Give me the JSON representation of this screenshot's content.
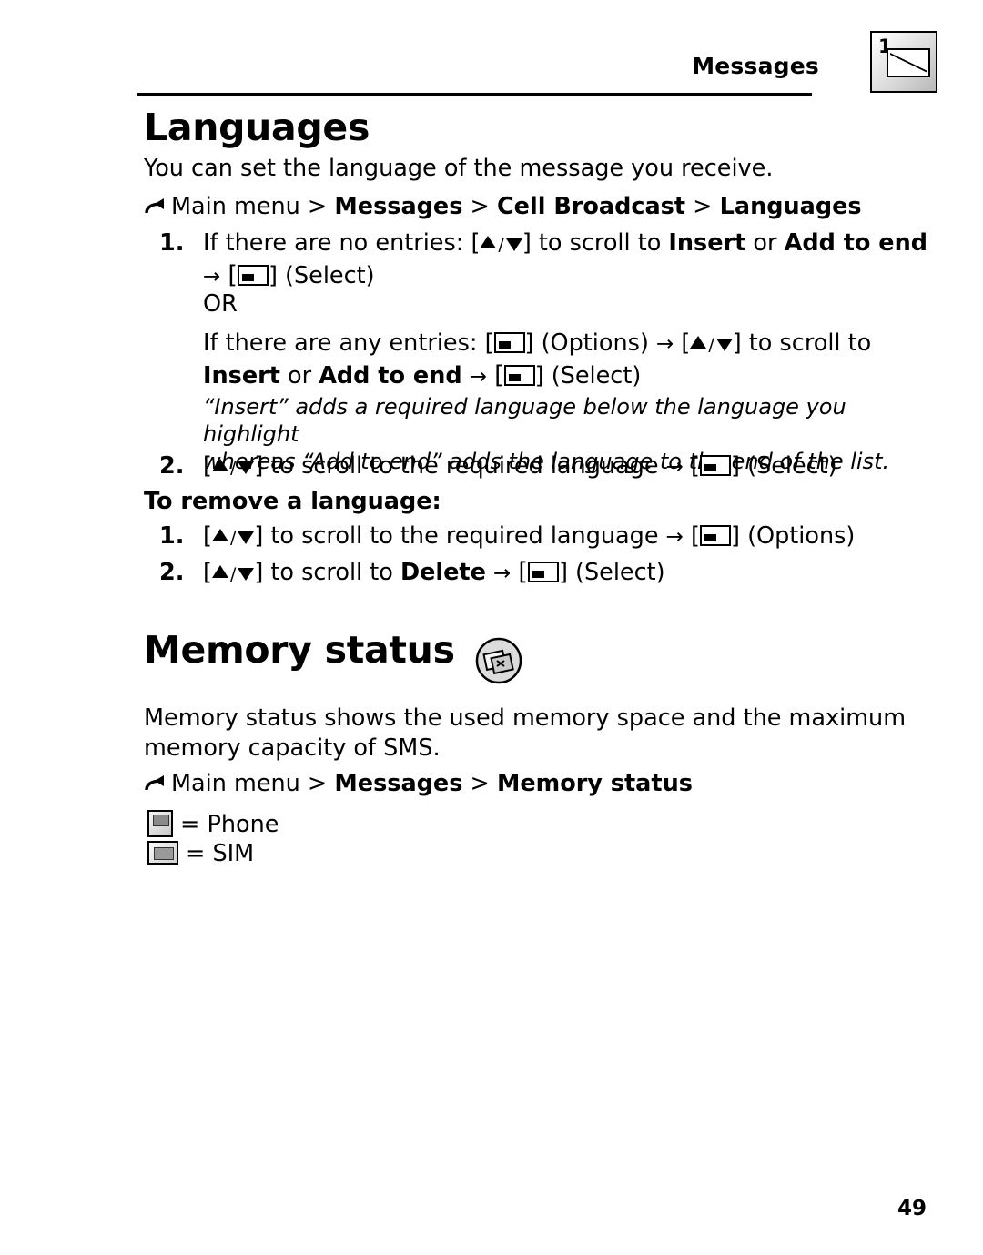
{
  "header": {
    "title": "Messages",
    "icon_name": "messages-envelope-icon",
    "icon_number": "1"
  },
  "sections": {
    "languages": {
      "heading": "Languages",
      "intro": "You can set the language of the message you receive.",
      "path": {
        "prefix": "Main menu > ",
        "b1": "Messages",
        "sep1": " > ",
        "b2": "Cell Broadcast",
        "sep2": " > ",
        "b3": "Languages"
      },
      "step1": {
        "num": "1.",
        "t1": "If there are no entries: [",
        "t2": "] to scroll to ",
        "b1": "Insert",
        "t3": " or ",
        "b2": "Add to end",
        "t4": " ",
        "t5": "] (Select)"
      },
      "or": "OR",
      "step1b": {
        "t1": "If there are any entries: [",
        "t2": "] (Options) ",
        "t3": " [",
        "t4": "] to scroll to",
        "b1": "Insert",
        "t5": " or ",
        "b2": "Add to end",
        "t6": " ",
        "t7": "] (Select)"
      },
      "note_line1": "“Insert” adds a required language below the language you highlight",
      "note_line2": "whereas “Add to end” adds the language to the end of the list.",
      "step2": {
        "num": "2.",
        "t1": "[",
        "t2": "] to scroll to the required language ",
        "t3": " [",
        "t4": "] (Select)"
      },
      "remove_heading": "To remove a language:",
      "remove_step1": {
        "num": "1.",
        "t1": "[",
        "t2": "] to scroll to the required language ",
        "t3": " [",
        "t4": "] (Options)"
      },
      "remove_step2": {
        "num": "2.",
        "t1": "[",
        "t2": "] to scroll to ",
        "b1": "Delete",
        "t3": " ",
        "t4": "] (Select)"
      }
    },
    "memory_status": {
      "heading": "Memory status",
      "icon_name": "memory-status-icon",
      "intro_line1": "Memory status shows the used memory space and the maximum",
      "intro_line2": "memory capacity of SMS.",
      "path": {
        "prefix": "Main menu > ",
        "b1": "Messages",
        "sep1": " > ",
        "b2": "Memory status"
      },
      "legend_phone": "= Phone",
      "legend_sim": "= SIM"
    }
  },
  "footer": {
    "page_number": "49"
  }
}
